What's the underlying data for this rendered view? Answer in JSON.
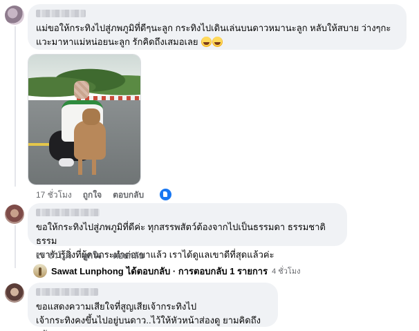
{
  "comments": [
    {
      "text_lines": [
        "แม่ขอให้กระทิงไปสู่ภพภูมิที่ดีๆนะลูก กระทิงไปเดินเล่นบนดาวหมานะลูก หลับให้สบาย ว่างๆกะ",
        "แวะมาหาแม่หน่อยนะลูก รักคิดถึงเสมอเลย"
      ],
      "emoji": "crying-face-emoji",
      "time": "17 ชั่วโมง",
      "like_label": "ถูกใจ",
      "reply_label": "ตอบกลับ",
      "reaction": "like"
    },
    {
      "text_lines": [
        "ขอให้กระทิงไปสู่ภพภูมิที่ดีค่ะ ทุกสรรพสัตว์ต้องจากไปเป็นธรรมดา ธรรมชาติ ธรรม",
        "เขารับรู้สิ่งที่ผู้คนกระทำต่อเขาแล้ว เราได้ดูแลเขาดีที่สุดแล้วค่ะ"
      ],
      "time": "17 ชั่วโมง",
      "like_label": "ถูกใจ",
      "reply_label": "ตอบกลับ"
    },
    {
      "text_lines": [
        "ขอแสดงความเสียใจที่สูญเสียเจ้ากระทิงไป",
        "เจ้ากระทิงคงขึ้นไปอยู่บนดาว..ไว้ให้หัวหน้าส่องดู ยามคิดถึงครับ"
      ]
    }
  ],
  "reply_summary": {
    "name": "Sawat Lunphong",
    "text": "ได้ตอบกลับ · การตอบกลับ 1 รายการ",
    "time": "4 ชั่วโมง"
  }
}
